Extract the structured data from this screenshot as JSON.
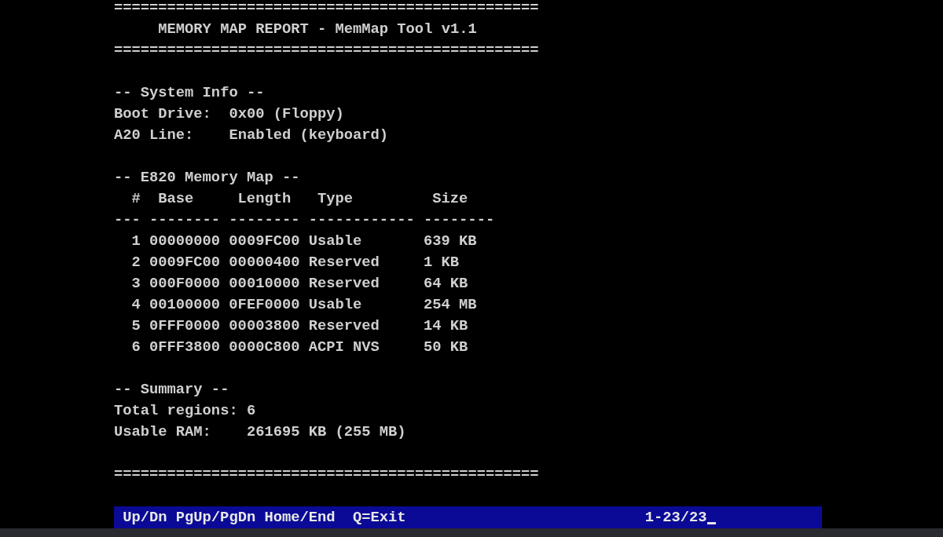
{
  "screen": {
    "rule_top": "================================================",
    "title": "MEMORY MAP REPORT - MemMap Tool v1.1",
    "rule_title": "================================================",
    "system_info": {
      "heading": "-- System Info --",
      "fields": [
        {
          "label": "Boot Drive:",
          "value": "0x00 (Floppy)"
        },
        {
          "label": "A20 Line:",
          "value": "Enabled (keyboard)"
        }
      ]
    },
    "memory_map": {
      "heading": "-- E820 Memory Map --",
      "columns": [
        "#",
        "Base",
        "Length",
        "Type",
        "Size"
      ],
      "separators": [
        "---",
        "--------",
        "--------",
        "------------",
        "--------"
      ],
      "rows": [
        [
          "1",
          "00000000",
          "0009FC00",
          "Usable",
          "639 KB"
        ],
        [
          "2",
          "0009FC00",
          "00000400",
          "Reserved",
          "1 KB"
        ],
        [
          "3",
          "000F0000",
          "00010000",
          "Reserved",
          "64 KB"
        ],
        [
          "4",
          "00100000",
          "0FEF0000",
          "Usable",
          "254 MB"
        ],
        [
          "5",
          "0FFF0000",
          "00003800",
          "Reserved",
          "14 KB"
        ],
        [
          "6",
          "0FFF3800",
          "0000C800",
          "ACPI NVS",
          "50 KB"
        ]
      ]
    },
    "summary": {
      "heading": "-- Summary --",
      "fields": [
        {
          "label": "Total regions:",
          "value": "6"
        },
        {
          "label": "Usable RAM:",
          "value": "261695 KB (255 MB)"
        }
      ]
    },
    "rule_bottom": "================================================"
  },
  "status_bar": {
    "keys": "Up/Dn PgUp/PgDn Home/End  Q=Exit",
    "position": "1-23/23"
  }
}
